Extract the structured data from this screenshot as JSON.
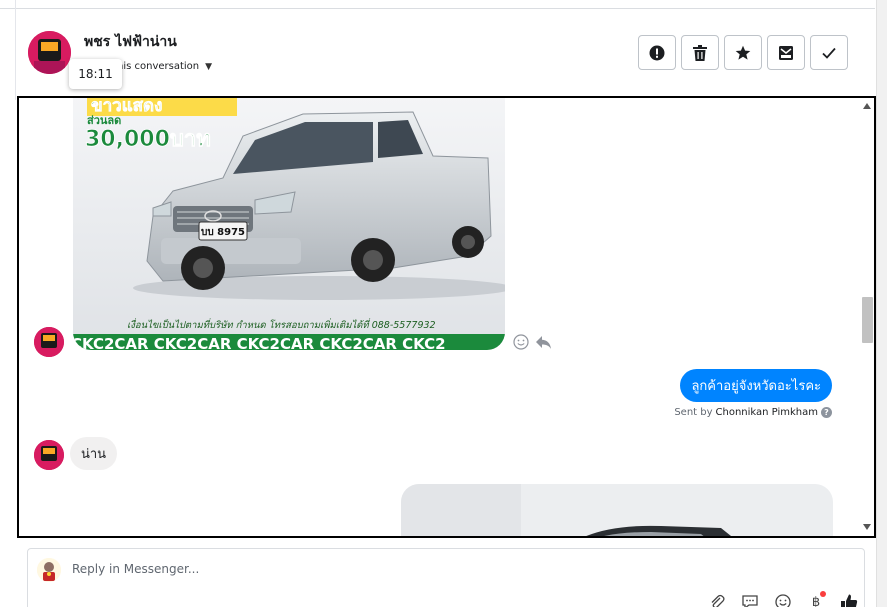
{
  "header": {
    "contact_name": "พชร ไฟฟ้าน่าน",
    "assign_text": "his conversation",
    "tooltip_time": "18:11"
  },
  "actions": [
    {
      "name": "mark-spam",
      "icon": "exclamation-circle-icon"
    },
    {
      "name": "delete",
      "icon": "trash-icon"
    },
    {
      "name": "star",
      "icon": "star-icon"
    },
    {
      "name": "mark-unread",
      "icon": "envelope-icon"
    },
    {
      "name": "mark-done",
      "icon": "checkmark-icon"
    }
  ],
  "messages": {
    "image_ad": {
      "promo_line1": "ขาวแสดง",
      "promo_line2": "ส่วนลด",
      "promo_amount": "30,000บาท",
      "plate": "บบ 8975",
      "caption": "เงื่อนไขเป็นไปตามที่บริษัท กำหนด โทรสอบถามเพิ่มเติมได้ที่ 088-5577932",
      "banner": "CKC2CAR CKC2CAR CKC2CAR CKC2CAR CKC2"
    },
    "outgoing_text": "ลูกค้าอยู่จังหวัดอะไรคะ",
    "sent_by_label": "Sent by",
    "sent_by_name": "Chonnikan Pimkham",
    "incoming_text": "น่าน"
  },
  "composer": {
    "placeholder": "Reply in Messenger..."
  },
  "composer_tools": [
    "paperclip-icon",
    "chat-bubble-icon",
    "emoji-icon",
    "baht-payment-icon",
    "thumbs-up-icon"
  ],
  "colors": {
    "brand_blue": "#0084ff",
    "avatar_pink": "#c2185b",
    "banner_green": "#1b8a3c",
    "incoming_bubble": "#f1f0f0"
  }
}
